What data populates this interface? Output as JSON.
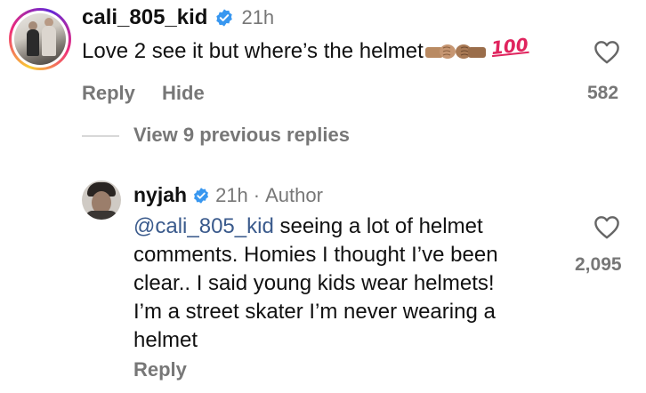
{
  "top_comment": {
    "username": "cali_805_kid",
    "time": "21h",
    "text": "Love 2 see it but where’s the helmet",
    "emoji_text": "100",
    "reply_label": "Reply",
    "hide_label": "Hide",
    "like_count": "582"
  },
  "view_replies_label": "View 9 previous replies",
  "reply": {
    "username": "nyjah",
    "time": "21h",
    "separator": "·",
    "author_label": "Author",
    "mention": "@cali_805_kid",
    "text_line1": " seeing a lot of helmet",
    "text_line2": "comments. Homies I thought I’ve been",
    "text_line3": "clear.. I said young kids wear helmets!",
    "text_line4": "I’m a street skater I’m never wearing a",
    "text_line5": "helmet",
    "reply_label": "Reply",
    "like_count": "2,095"
  },
  "colors": {
    "verified": "#3897f0",
    "muted": "#777777",
    "mention": "#3a5a8c",
    "hundred_emoji": "#e0245e"
  },
  "icons": [
    "verified-badge-icon",
    "heart-icon",
    "fist-bump-emoji",
    "hundred-points-emoji"
  ]
}
